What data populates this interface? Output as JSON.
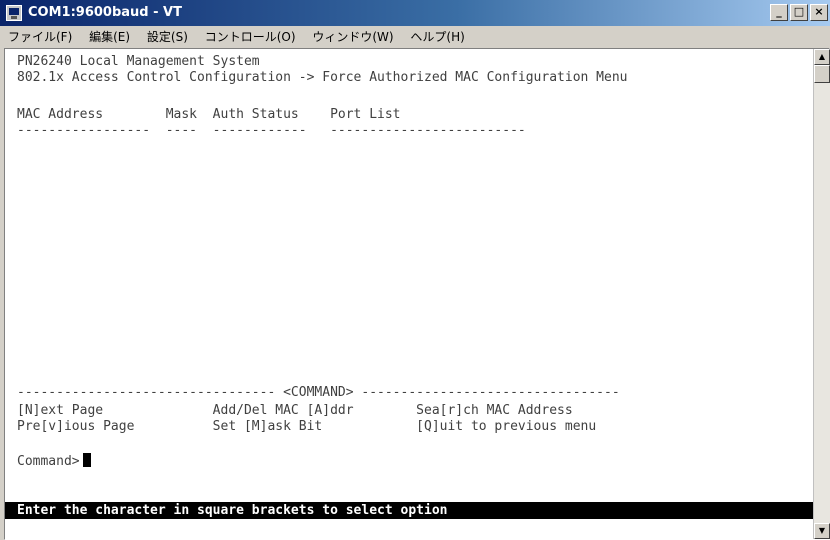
{
  "window": {
    "title": "COM1:9600baud - VT",
    "minimize_label": "_",
    "maximize_label": "□",
    "close_label": "×"
  },
  "menubar": {
    "items": [
      "ファイル(F)",
      "編集(E)",
      "設定(S)",
      "コントロール(O)",
      "ウィンドウ(W)",
      "ヘルプ(H)"
    ]
  },
  "terminal": {
    "header1": "PN26240 Local Management System",
    "header2": "802.1x Access Control Configuration -> Force Authorized MAC Configuration Menu",
    "table_header": "MAC Address        Mask  Auth Status    Port List",
    "table_underline": "-----------------  ----  ------------   -------------------------",
    "command_separator": "--------------------------------- <COMMAND> ---------------------------------",
    "commands_row1": "[N]ext Page              Add/Del MAC [A]ddr        Sea[r]ch MAC Address",
    "commands_row2": "Pre[v]ious Page          Set [M]ask Bit            [Q]uit to previous menu",
    "prompt": "Command>",
    "status": "Enter the character in square brackets to select option"
  },
  "colors": {
    "title_gradient_start": "#0a246a",
    "title_gradient_end": "#a6caf0",
    "terminal_bg": "#ffffff",
    "terminal_text": "#404040",
    "status_bg": "#000000",
    "status_text": "#ffffff"
  },
  "icons": {
    "app": "terminal-app-icon",
    "scroll_up": "scroll-up-arrow-icon",
    "scroll_down": "scroll-down-arrow-icon"
  }
}
